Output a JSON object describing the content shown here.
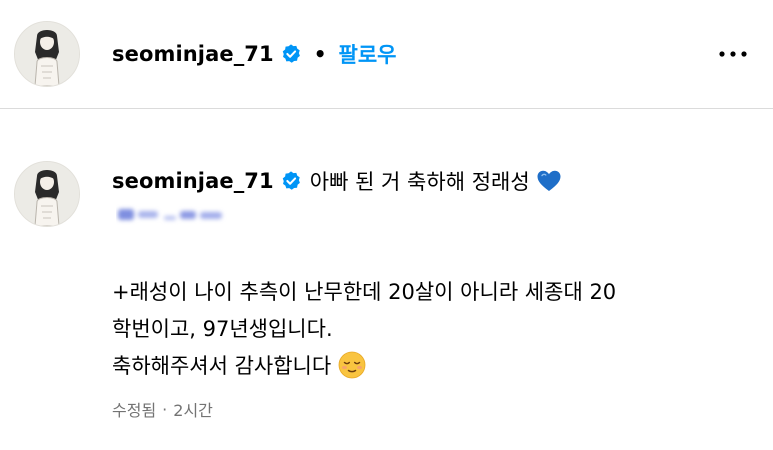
{
  "post_header": {
    "username": "seominjae_71",
    "verified_icon": "verified-badge-icon",
    "separator": "•",
    "follow_label": "팔로우",
    "more_icon": "more-options-icon"
  },
  "comment": {
    "username": "seominjae_71",
    "caption": "아빠 된 거 축하해 정래성",
    "caption_emoji": "blue-heart-icon",
    "mention_blurred": true,
    "lines": [
      "+래성이 나이 추측이 난무한데 20살이 아니라 세종대 20",
      "학번이고, 97년생입니다.",
      "축하해주셔서 감사합니다"
    ],
    "trailing_emoji": "relieved-face-icon",
    "edited_label": "수정됨",
    "meta_separator": "·",
    "time_ago": "2시간"
  },
  "colors": {
    "link_blue": "#0095f6",
    "verified_blue": "#0095f6",
    "muted_text": "#737373",
    "divider": "#dbdbdb"
  }
}
